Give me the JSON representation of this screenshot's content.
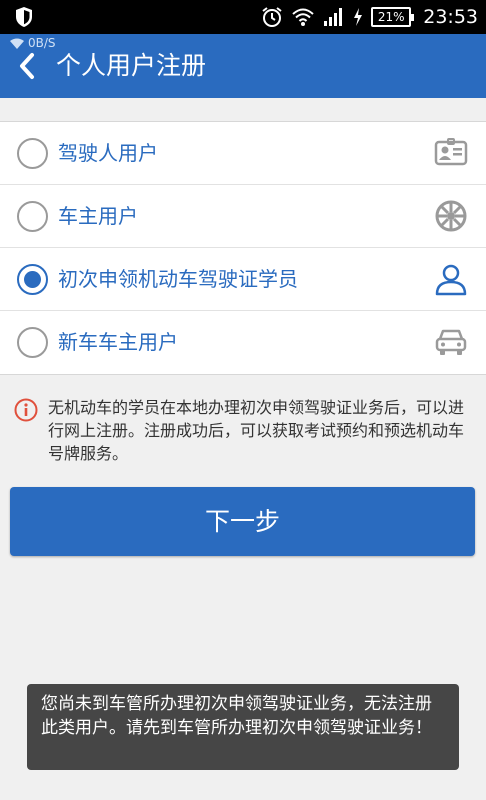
{
  "status_bar": {
    "time": "23:53",
    "battery": "21%",
    "icons": [
      "shield-icon",
      "alarm-icon",
      "wifi-icon",
      "signal-icon",
      "charging-icon",
      "battery-icon"
    ]
  },
  "header": {
    "net_speed": "0B/S",
    "title": "个人用户注册",
    "back_icon": "chevron-left-icon",
    "background": "#2a6bbf"
  },
  "options": [
    {
      "label": "驾驶人用户",
      "icon": "id-card-icon",
      "checked": false
    },
    {
      "label": "车主用户",
      "icon": "wheel-icon",
      "checked": false
    },
    {
      "label": "初次申领机动车驾驶证学员",
      "icon": "person-icon",
      "checked": true
    },
    {
      "label": "新车车主用户",
      "icon": "car-icon",
      "checked": false
    }
  ],
  "notice": {
    "icon": "info-icon",
    "text": "无机动车的学员在本地办理初次申领驾驶证业务后，可以进行网上注册。注册成功后，可以获取考试预约和预选机动车号牌服务。"
  },
  "next_button": {
    "label": "下一步"
  },
  "toast": {
    "text": "您尚未到车管所办理初次申领驾驶证业务，无法注册此类用户。请先到车管所办理初次申领驾驶证业务！"
  }
}
